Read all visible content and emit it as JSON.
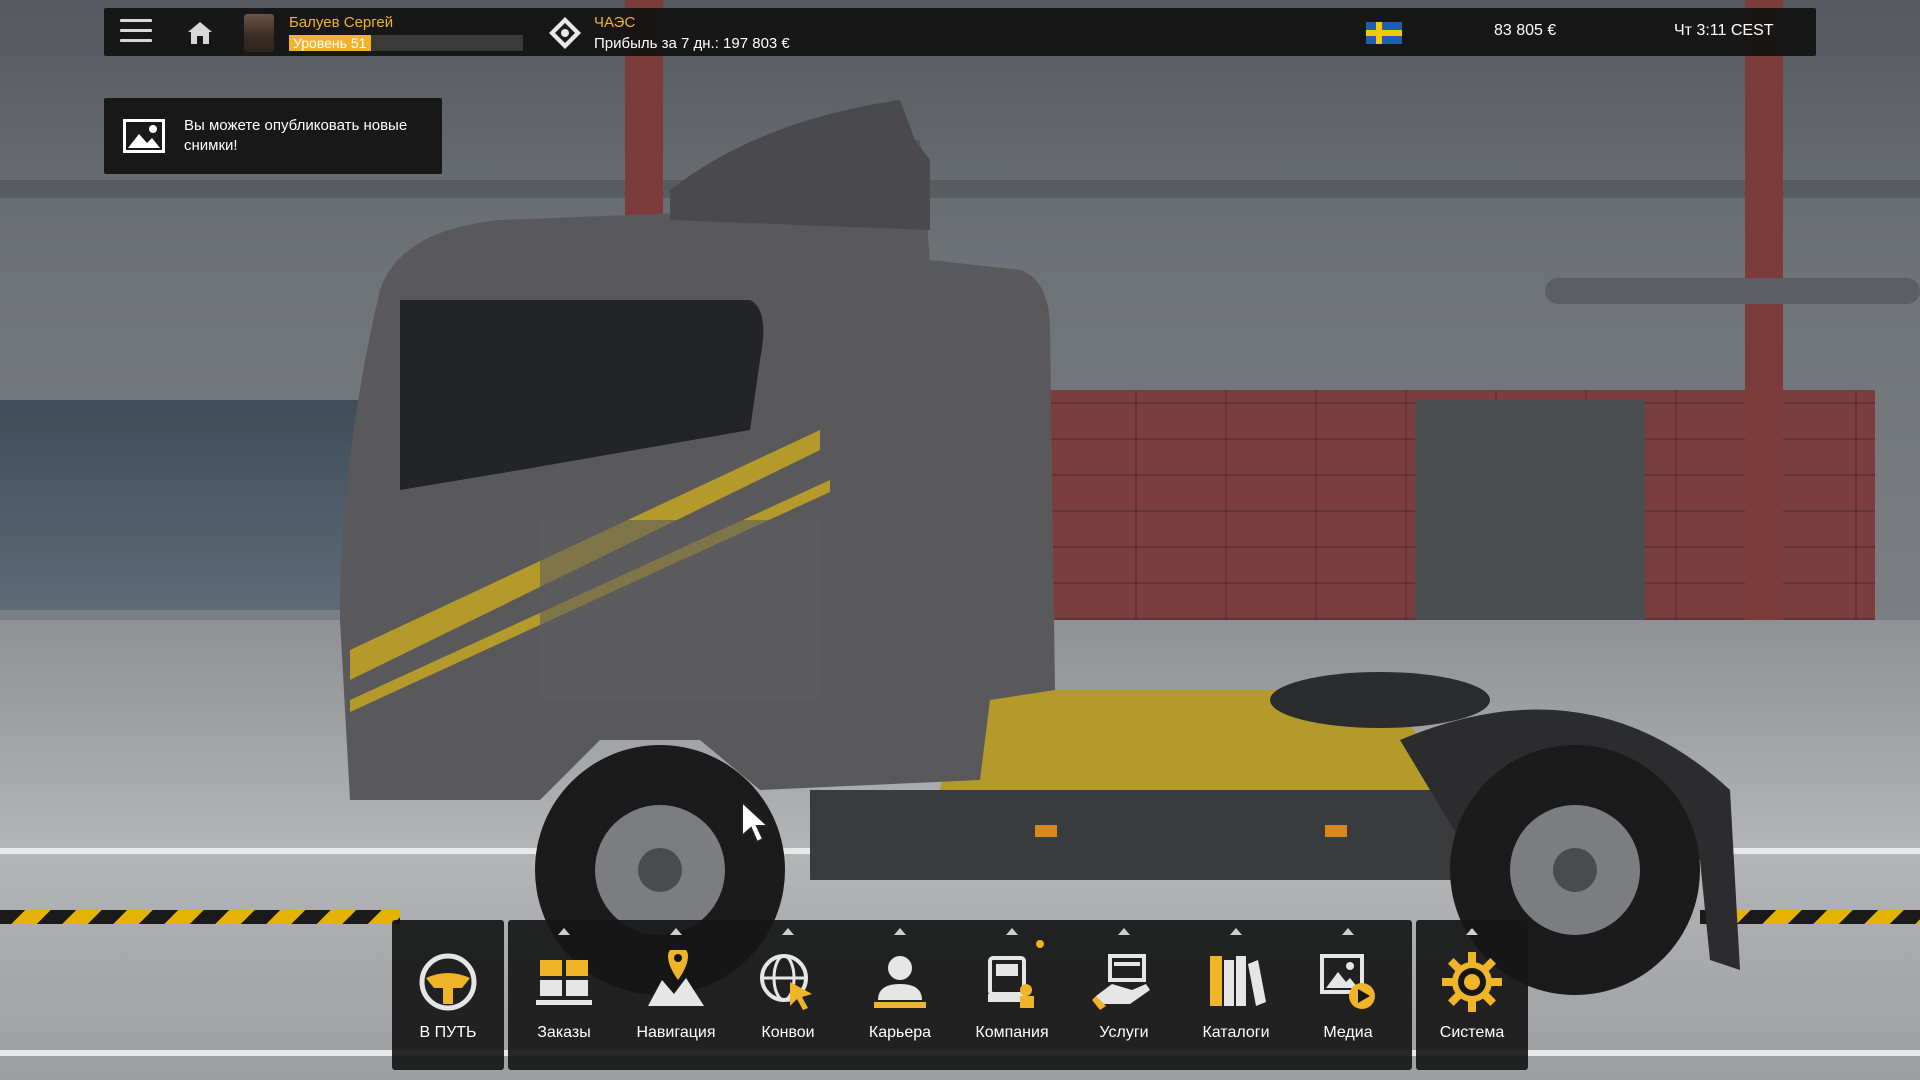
{
  "topbar": {
    "player_name": "Балуев Сергей",
    "level_label": "Уровень 51",
    "level_progress_percent": 35,
    "company_name": "ЧАЭС",
    "company_profit": "Прибыль за 7 дн.: 197 803 €",
    "country_flag": "sweden",
    "money": "83 805 €",
    "clock": "Чт 3:11 CEST"
  },
  "notification": {
    "text": "Вы можете опубликовать новые снимки!"
  },
  "dock": {
    "items": [
      {
        "label": "В ПУТЬ",
        "icon": "steering-wheel-icon"
      },
      {
        "label": "Заказы",
        "icon": "cargo-boxes-icon"
      },
      {
        "label": "Навигация",
        "icon": "map-pin-icon"
      },
      {
        "label": "Конвои",
        "icon": "globe-cursor-icon"
      },
      {
        "label": "Карьера",
        "icon": "person-icon"
      },
      {
        "label": "Компания",
        "icon": "truck-company-icon"
      },
      {
        "label": "Услуги",
        "icon": "hand-service-icon"
      },
      {
        "label": "Каталоги",
        "icon": "books-icon"
      },
      {
        "label": "Медиа",
        "icon": "media-play-icon"
      },
      {
        "label": "Система",
        "icon": "gear-icon"
      }
    ]
  },
  "colors": {
    "accent": "#f0b429",
    "panel": "#121212"
  }
}
